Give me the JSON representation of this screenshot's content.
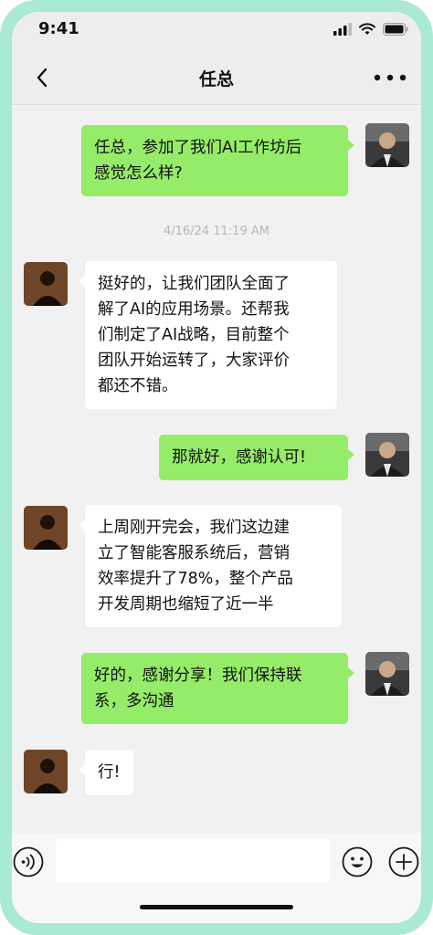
{
  "status_bar": {
    "time": "9:41"
  },
  "nav": {
    "title": "任总"
  },
  "timestamp": "4/16/24 11:19 AM",
  "messages": [
    {
      "from": "self",
      "text": "任总，参加了我们AI工作坊后\n感觉怎么样?"
    },
    {
      "from": "other",
      "text": "挺好的，让我们团队全面了\n解了AI的应用场景。还帮我\n们制定了AI战略，目前整个\n团队开始运转了，大家评价\n都还不错。"
    },
    {
      "from": "self",
      "text": "那就好，感谢认可!"
    },
    {
      "from": "other",
      "text": "上周刚开完会，我们这边建\n立了智能客服系统后，营销\n效率提升了78%，整个产品\n开发周期也缩短了近一半"
    },
    {
      "from": "self",
      "text": "好的，感谢分享！我们保持联\n系，多沟通"
    },
    {
      "from": "other",
      "text": "行!"
    }
  ],
  "input_bar": {
    "value": "",
    "placeholder": ""
  },
  "colors": {
    "frame": "#a9ead2",
    "outgoing_bubble": "#95ec69",
    "incoming_bubble": "#ffffff",
    "background": "#f1f1f1"
  },
  "icons": [
    "back-chevron-icon",
    "more-dots-icon",
    "voice-icon",
    "emoji-icon",
    "plus-icon",
    "signal-icon",
    "wifi-icon",
    "battery-icon"
  ]
}
